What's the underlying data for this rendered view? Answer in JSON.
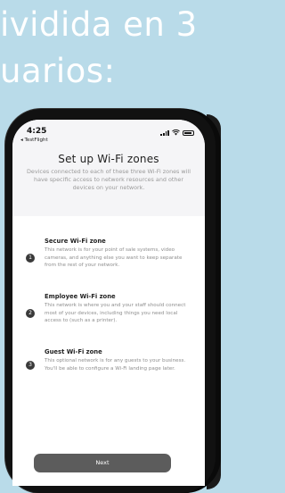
{
  "headline": {
    "line1": "ividida en 3",
    "line2": "uarios:"
  },
  "status_bar": {
    "time": "4:25",
    "back_label": "◂ TestFlight"
  },
  "screen": {
    "title": "Set up Wi-Fi zones",
    "subtitle": "Devices connected to each of these three Wi-Fi zones will have specific access to network resources and other devices on your network.",
    "zones": [
      {
        "number": "1",
        "title": "Secure Wi-Fi zone",
        "description": "This network is for your point of sale systems, video cameras, and anything else you want to keep separate from the rest of your network."
      },
      {
        "number": "2",
        "title": "Employee Wi-Fi zone",
        "description": "This network is where you and your staff should connect most of your devices, including things you need local access to (such as a printer)."
      },
      {
        "number": "3",
        "title": "Guest Wi-Fi zone",
        "description": "This optional network is for any guests to your business. You'll be able to configure a Wi-Fi landing page later."
      }
    ],
    "next_label": "Next"
  },
  "colors": {
    "background": "#b9dbe9",
    "button": "#5c5c5c",
    "header_bg": "#f5f5f7"
  },
  "icons": [
    "signal-icon",
    "wifi-icon",
    "battery-icon"
  ]
}
